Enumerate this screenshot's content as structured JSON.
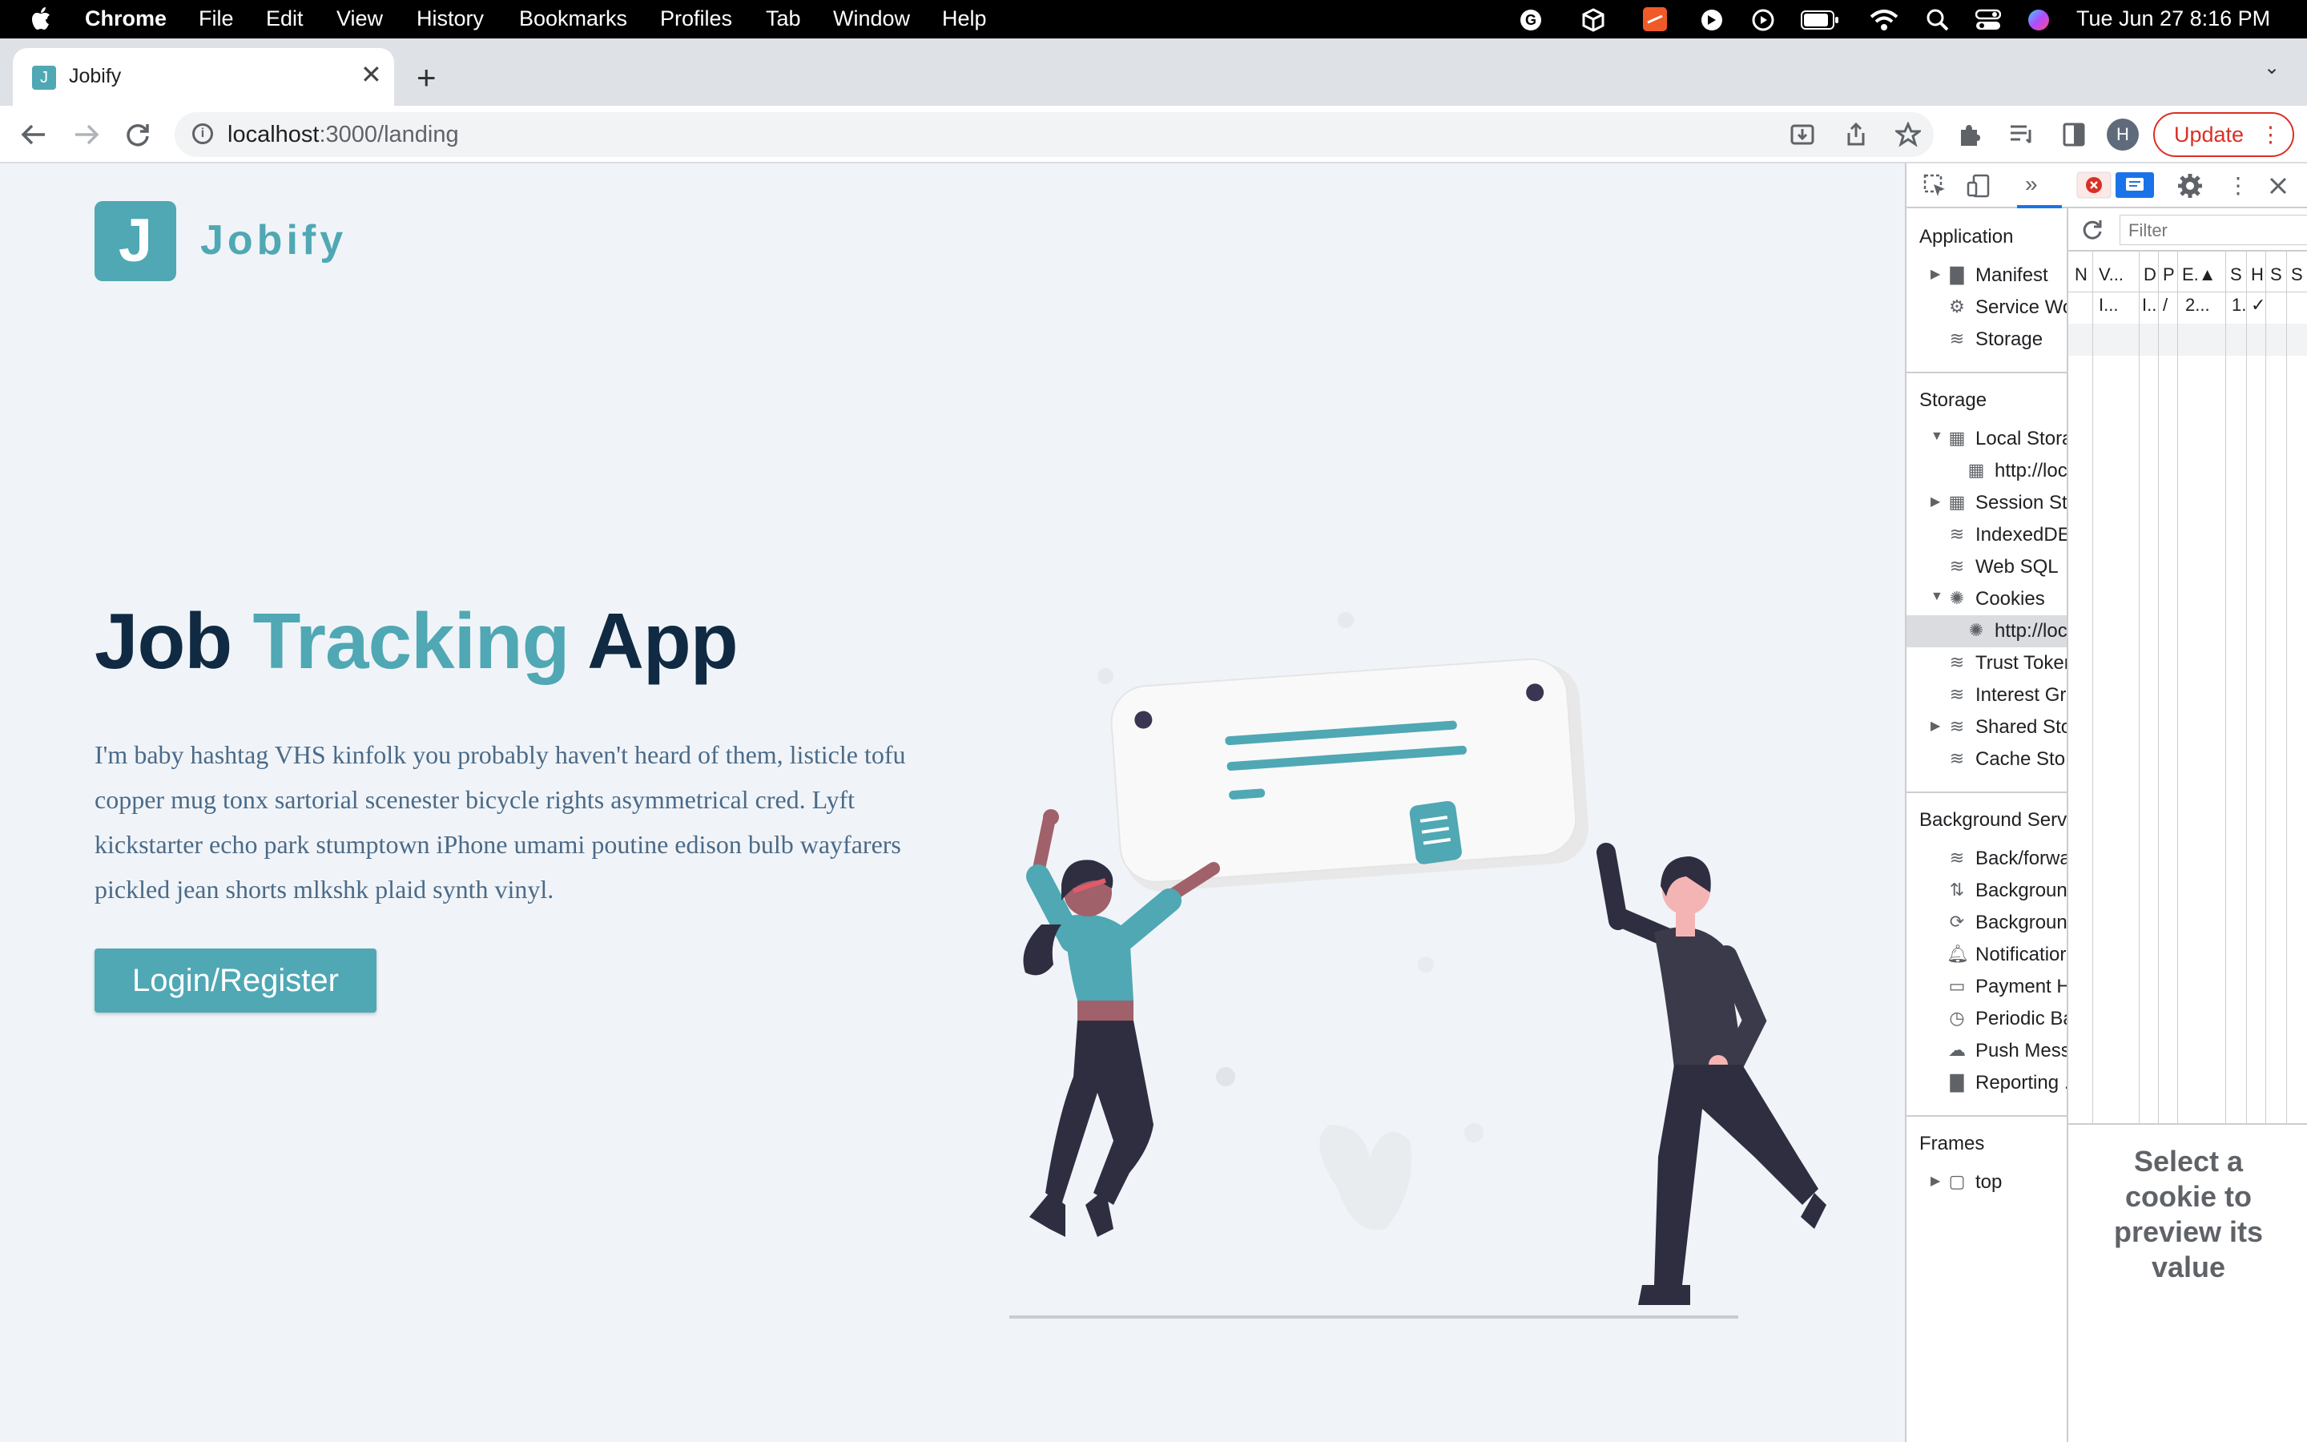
{
  "menubar": {
    "apple": "",
    "app": "Chrome",
    "items": [
      "File",
      "Edit",
      "View",
      "History",
      "Bookmarks",
      "Profiles",
      "Tab",
      "Window",
      "Help"
    ],
    "datetime": "Tue Jun 27  8:16 PM"
  },
  "tab": {
    "favicon": "J",
    "title": "Jobify",
    "close": "✕"
  },
  "newtab": "+",
  "tab_menu": "⌄",
  "toolbar": {
    "url_host": "localhost",
    "url_path": ":3000/landing",
    "avatar": "H",
    "update_label": "Update",
    "update_menu": "⋮"
  },
  "page": {
    "logo_letter": "J",
    "logo_text": "Jobify",
    "title_part1": "Job ",
    "title_accent": "Tracking",
    "title_part3": " App",
    "description": "I'm baby hashtag VHS kinfolk you probably haven't heard of them, listicle tofu copper mug tonx sartorial scenester bicycle rights asymmetrical cred. Lyft kickstarter echo park stumptown iPhone umami poutine edison bulb wayfarers pickled jean shorts mlkshk plaid synth vinyl.",
    "cta_label": "Login/Register"
  },
  "devtools": {
    "more_tabs": "»",
    "sections": {
      "application": "Application",
      "storage": "Storage",
      "background": "Background Serv",
      "frames": "Frames"
    },
    "application_items": [
      "Manifest",
      "Service Wo",
      "Storage"
    ],
    "storage_items": [
      "Local Stora",
      "http://loc",
      "Session St",
      "IndexedDE",
      "Web SQL",
      "Cookies",
      "http://loc",
      "Trust Toker",
      "Interest Gr",
      "Shared Sto",
      "Cache Sto"
    ],
    "background_items": [
      "Back/forwa",
      "Backgroun",
      "Backgroun",
      "Notificatior",
      "Payment H",
      "Periodic Ba",
      "Push Mess",
      "Reporting ."
    ],
    "frames_items": [
      "top"
    ],
    "filter_placeholder": "Filter",
    "columns": [
      "N",
      "V...",
      "D",
      "P",
      "E.▲",
      "S",
      "H",
      "S",
      "S"
    ],
    "row": [
      "",
      "I...",
      "I..",
      "/",
      "2...",
      "1.",
      "✓",
      "",
      ""
    ],
    "preview_text": "Select a cookie to preview its value"
  }
}
